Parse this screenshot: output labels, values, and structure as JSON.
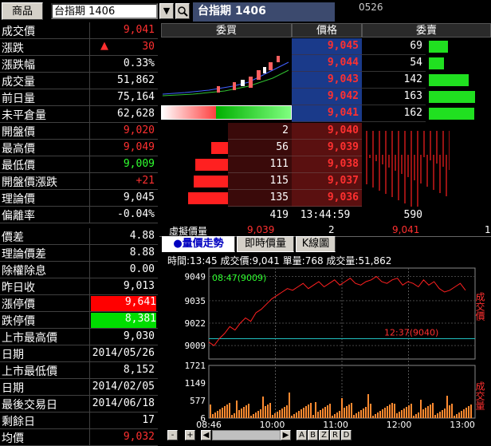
{
  "toolbar": {
    "tab_label": "商品",
    "symbol_input": "台指期  1406",
    "dropdown_icon": "▼",
    "search_icon": "magnifier-icon",
    "title": "台指期  1406",
    "code": "0526"
  },
  "colors": {
    "up": "#ff3030",
    "down": "#30ff30",
    "neutral": "#ffffff",
    "limit_up_bg": "#ff0000",
    "limit_down_bg": "#00dd00"
  },
  "quote": [
    {
      "label": "成交價",
      "value": "9,041",
      "color": "up"
    },
    {
      "label": "漲跌",
      "value": "30",
      "color": "up",
      "arrow": "▲"
    },
    {
      "label": "漲跌幅",
      "value": "0.33%",
      "color": "neutral"
    },
    {
      "label": "成交量",
      "value": "51,862",
      "color": "neutral"
    },
    {
      "label": "前日量",
      "value": "75,164",
      "color": "neutral"
    },
    {
      "label": "未平倉量",
      "value": "62,628",
      "color": "neutral"
    },
    {
      "label": "開盤價",
      "value": "9,020",
      "color": "up"
    },
    {
      "label": "最高價",
      "value": "9,049",
      "color": "up"
    },
    {
      "label": "最低價",
      "value": "9,009",
      "color": "down"
    },
    {
      "label": "開盤價漲跌",
      "value": "+21",
      "color": "up"
    },
    {
      "label": "理論價",
      "value": "9,045",
      "color": "neutral"
    },
    {
      "label": "偏離率",
      "value": "-0.04%",
      "color": "neutral"
    }
  ],
  "details": [
    {
      "label": "價差",
      "value": "4.88",
      "color": "neutral"
    },
    {
      "label": "理論價差",
      "value": "8.88",
      "color": "neutral"
    },
    {
      "label": "除權除息",
      "value": "0.00",
      "color": "neutral"
    },
    {
      "label": "昨日收",
      "value": "9,013",
      "color": "neutral"
    },
    {
      "label": "漲停價",
      "value": "9,641",
      "color": "limit_up"
    },
    {
      "label": "跌停價",
      "value": "8,381",
      "color": "limit_down"
    },
    {
      "label": "上市最高價",
      "value": "9,030",
      "color": "neutral"
    },
    {
      "label": "日期",
      "value": "2014/05/26",
      "color": "neutral"
    },
    {
      "label": "上市最低價",
      "value": "8,152",
      "color": "neutral"
    },
    {
      "label": "日期",
      "value": "2014/02/05",
      "color": "neutral"
    },
    {
      "label": "最後交易日",
      "value": "2014/06/18",
      "color": "neutral"
    },
    {
      "label": "剩餘日",
      "value": "17",
      "color": "neutral"
    },
    {
      "label": "均價",
      "value": "9,032",
      "color": "up"
    }
  ],
  "book": {
    "headers": {
      "bid": "委買",
      "price": "價格",
      "ask": "委賣"
    },
    "asks": [
      {
        "price": "9,045",
        "qty": "69",
        "bar": 0.42
      },
      {
        "price": "9,044",
        "qty": "54",
        "bar": 0.33
      },
      {
        "price": "9,043",
        "qty": "142",
        "bar": 0.87
      },
      {
        "price": "9,042",
        "qty": "163",
        "bar": 1.0
      },
      {
        "price": "9,041",
        "qty": "162",
        "bar": 0.99
      }
    ],
    "bids": [
      {
        "price": "9,040",
        "qty": "2",
        "bar": 0.0
      },
      {
        "price": "9,039",
        "qty": "56",
        "bar": 0.41
      },
      {
        "price": "9,038",
        "qty": "111",
        "bar": 0.82
      },
      {
        "price": "9,037",
        "qty": "115",
        "bar": 0.85
      },
      {
        "price": "9,036",
        "qty": "135",
        "bar": 1.0
      }
    ],
    "total_bid": "419",
    "time": "13:44:59",
    "total_ask": "590",
    "virtual_label": "虛擬價量",
    "virtual_price": "9,039",
    "virtual_qty": "2",
    "virtual_price2": "9,041",
    "virtual_qty2": "1"
  },
  "chart_tabs": [
    "●量價走勢",
    "即時價量",
    "K線圖"
  ],
  "chart_info": "時間:13:45 成交價:9,041 單量:768 成交量:51,862",
  "chart_labels": {
    "price_side": "成交價",
    "vol_side": "成交量",
    "max_note": "08:47(9009)",
    "min_note": "12:37(9040)"
  },
  "chart_data": {
    "type": "line",
    "x_ticks": [
      "08:46",
      "10:00",
      "11:00",
      "12:00",
      "13:00"
    ],
    "price_ticks": [
      9049,
      9035,
      9022,
      9009
    ],
    "volume_ticks": [
      1721,
      1149,
      577,
      6
    ],
    "ylim": [
      9004,
      9052
    ],
    "reference": 9013,
    "series": [
      {
        "values": [
          9011,
          9009,
          9013,
          9016,
          9020,
          9018,
          9022,
          9025,
          9023,
          9028,
          9030,
          9033,
          9036,
          9038,
          9040,
          9042,
          9041,
          9043,
          9045,
          9042,
          9044,
          9046,
          9043,
          9045,
          9047,
          9044,
          9046,
          9048,
          9045,
          9044,
          9046,
          9047,
          9049,
          9046,
          9045,
          9047,
          9048,
          9044,
          9046,
          9045,
          9043,
          9047,
          9044,
          9046,
          9042,
          9040,
          9041,
          9043,
          9045,
          9041
        ]
      }
    ]
  },
  "chart_footer": {
    "minus": "-",
    "plus": "+",
    "prev": "◀",
    "next": "▶",
    "btns": [
      "A",
      "B",
      "Z",
      "R",
      "D"
    ]
  }
}
